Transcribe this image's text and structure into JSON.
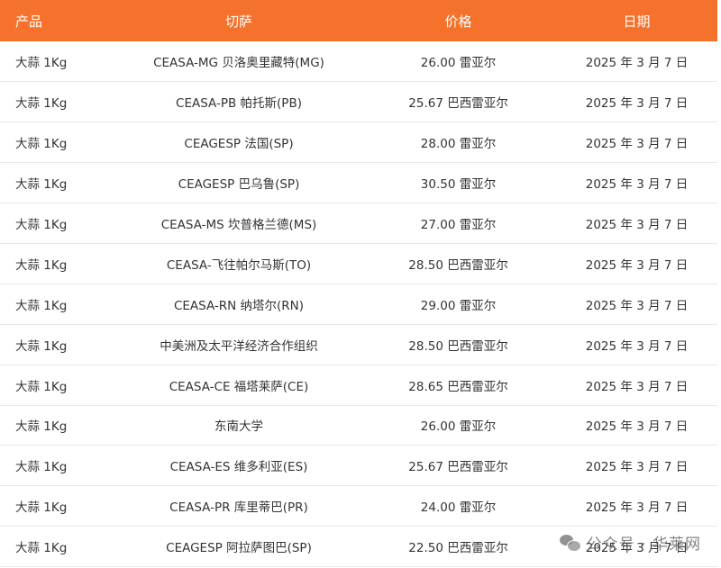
{
  "table": {
    "headers": {
      "product": "产品",
      "market": "切萨",
      "price": "价格",
      "date": "日期"
    },
    "rows": [
      {
        "product": "大蒜 1Kg",
        "market": "CEASA-MG 贝洛奥里藏特(MG)",
        "price": "26.00 雷亚尔",
        "date": "2025 年 3 月 7 日"
      },
      {
        "product": "大蒜 1Kg",
        "market": "CEASA-PB 帕托斯(PB)",
        "price": "25.67 巴西雷亚尔",
        "date": "2025 年 3 月 7 日"
      },
      {
        "product": "大蒜 1Kg",
        "market": "CEAGESP 法国(SP)",
        "price": "28.00 雷亚尔",
        "date": "2025 年 3 月 7 日"
      },
      {
        "product": "大蒜 1Kg",
        "market": "CEAGESP 巴乌鲁(SP)",
        "price": "30.50 雷亚尔",
        "date": "2025 年 3 月 7 日"
      },
      {
        "product": "大蒜 1Kg",
        "market": "CEASA-MS 坎普格兰德(MS)",
        "price": "27.00 雷亚尔",
        "date": "2025 年 3 月 7 日"
      },
      {
        "product": "大蒜 1Kg",
        "market": "CEASA-飞往帕尔马斯(TO)",
        "price": "28.50 巴西雷亚尔",
        "date": "2025 年 3 月 7 日"
      },
      {
        "product": "大蒜 1Kg",
        "market": "CEASA-RN 纳塔尔(RN)",
        "price": "29.00 雷亚尔",
        "date": "2025 年 3 月 7 日"
      },
      {
        "product": "大蒜 1Kg",
        "market": "中美洲及太平洋经济合作组织",
        "price": "28.50 巴西雷亚尔",
        "date": "2025 年 3 月 7 日"
      },
      {
        "product": "大蒜 1Kg",
        "market": "CEASA-CE 福塔莱萨(CE)",
        "price": "28.65 巴西雷亚尔",
        "date": "2025 年 3 月 7 日"
      },
      {
        "product": "大蒜 1Kg",
        "market": "东南大学",
        "price": "26.00 雷亚尔",
        "date": "2025 年 3 月 7 日"
      },
      {
        "product": "大蒜 1Kg",
        "market": "CEASA-ES 维多利亚(ES)",
        "price": "25.67 巴西雷亚尔",
        "date": "2025 年 3 月 7 日"
      },
      {
        "product": "大蒜 1Kg",
        "market": "CEASA-PR 库里蒂巴(PR)",
        "price": "24.00 雷亚尔",
        "date": "2025 年 3 月 7 日"
      },
      {
        "product": "大蒜 1Kg",
        "market": "CEAGESP 阿拉萨图巴(SP)",
        "price": "22.50 巴西雷亚尔",
        "date": "2025 年 3 月 7 日"
      }
    ]
  },
  "watermark": {
    "text": "公众号 · 华莱网",
    "icon": "wechat-icon"
  },
  "colors": {
    "header_bg": "#f4722b",
    "header_text": "#ffffff",
    "row_divider": "#e8e8e8",
    "body_text": "#333333"
  }
}
